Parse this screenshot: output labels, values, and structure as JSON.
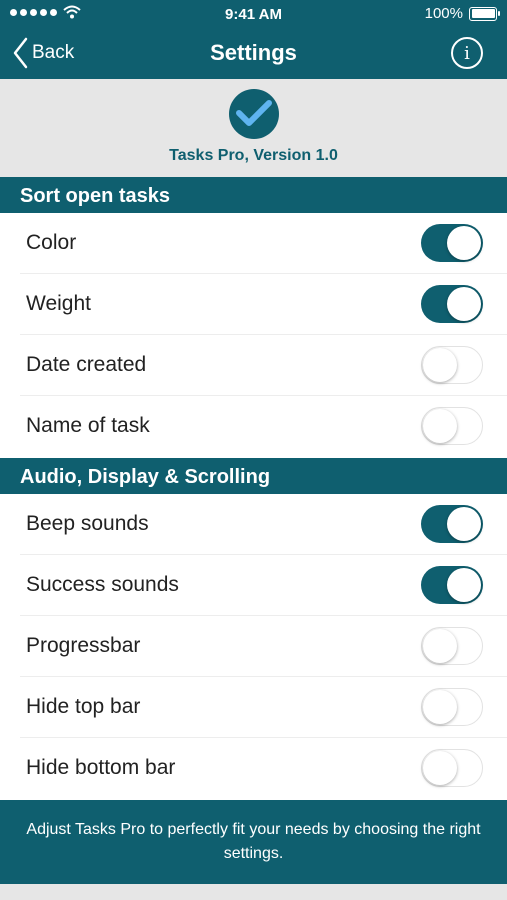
{
  "status_bar": {
    "time": "9:41 AM",
    "battery": "100%"
  },
  "nav": {
    "back_label": "Back",
    "title": "Settings",
    "info_glyph": "i"
  },
  "app": {
    "version_text": "Tasks Pro, Version 1.0"
  },
  "sections": [
    {
      "title": "Sort open tasks",
      "rows": [
        {
          "label": "Color",
          "on": true
        },
        {
          "label": "Weight",
          "on": true
        },
        {
          "label": "Date created",
          "on": false
        },
        {
          "label": "Name of task",
          "on": false
        }
      ]
    },
    {
      "title": "Audio, Display & Scrolling",
      "rows": [
        {
          "label": "Beep sounds",
          "on": true
        },
        {
          "label": "Success sounds",
          "on": true
        },
        {
          "label": "Progressbar",
          "on": false
        },
        {
          "label": "Hide top bar",
          "on": false
        },
        {
          "label": "Hide bottom bar",
          "on": false
        }
      ]
    }
  ],
  "footer": {
    "text": "Adjust Tasks Pro to perfectly fit your needs by choosing the right settings."
  },
  "colors": {
    "accent": "#0f5f6f",
    "header_bg": "#e6e6e6"
  }
}
